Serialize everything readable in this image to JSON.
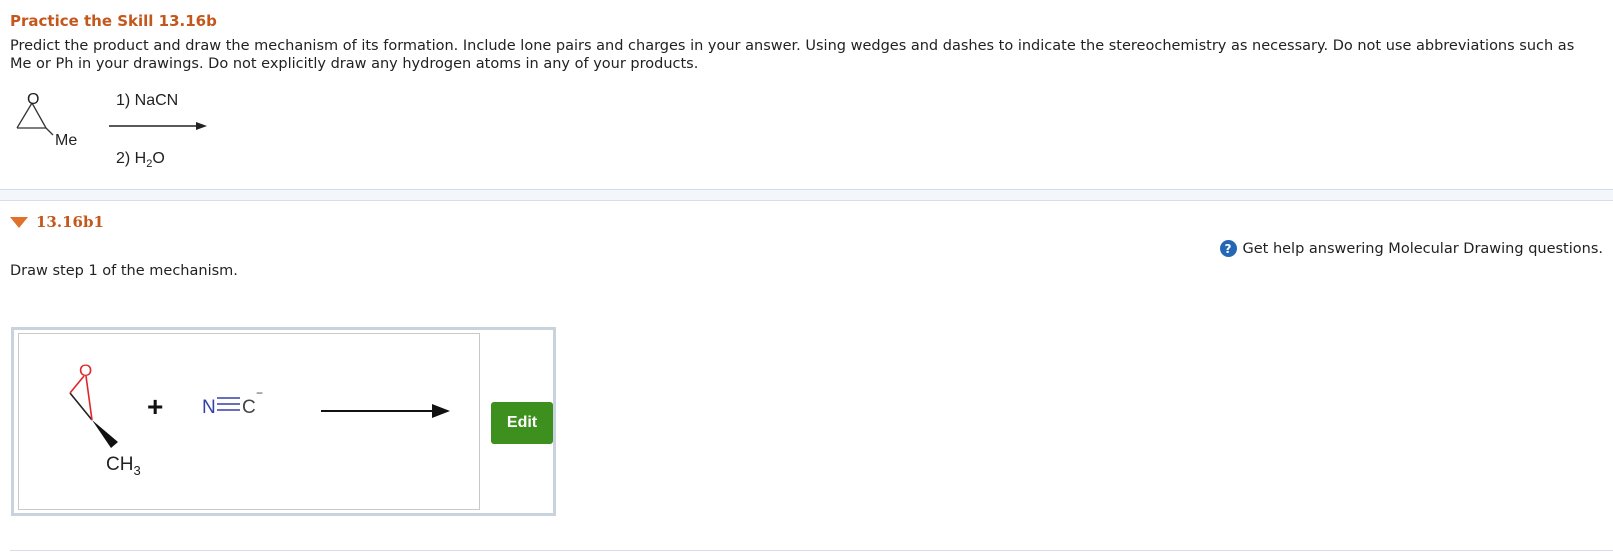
{
  "header": {
    "title": "Practice the Skill 13.16b",
    "prompt": "Predict the product and draw the mechanism of its formation. Include lone pairs and charges in your answer. Using wedges and dashes to indicate the stereochemistry as necessary. Do not use abbreviations such as Me or Ph in your drawings. Do not explicitly draw any hydrogen atoms in any of your products."
  },
  "reaction": {
    "substituent": "Me",
    "oxygen": "O",
    "reagent1": "1) NaCN",
    "reagent2_prefix": "2) H",
    "reagent2_sub": "2",
    "reagent2_suffix": "O"
  },
  "part": {
    "label": "13.16b1",
    "help_icon": "?",
    "help_text": "Get help answering Molecular Drawing questions.",
    "step_text": "Draw step 1 of the mechanism."
  },
  "drawing": {
    "oxygen": "O",
    "methyl": "CH",
    "methyl_sub": "3",
    "plus": "+",
    "nitrogen": "N",
    "carbon": "C",
    "charge": "−",
    "edit_label": "Edit"
  },
  "colors": {
    "title": "#c4571b",
    "oxygen": "#e0262b",
    "nitrogen": "#3340a8",
    "edit_button": "#3d8f1e",
    "help_icon": "#2467b4"
  }
}
